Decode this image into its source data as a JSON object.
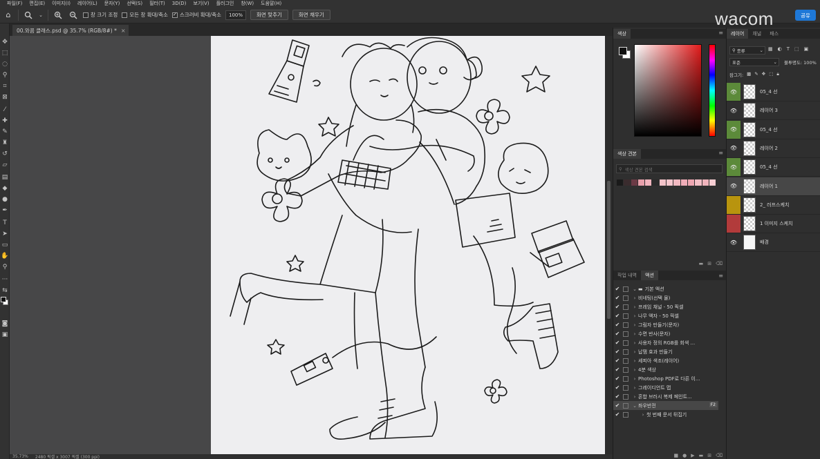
{
  "menubar": [
    "파일(F)",
    "편집(E)",
    "이미지(I)",
    "레이어(L)",
    "문자(Y)",
    "선택(S)",
    "필터(T)",
    "3D(D)",
    "보기(V)",
    "플러그인",
    "창(W)",
    "도움말(H)"
  ],
  "options": {
    "resize_windows": "창 크기 조정",
    "zoom_all": "모든 창 확대/축소",
    "scrubby_zoom": "스크러비 확대/축소",
    "zoom_value": "100%",
    "fit_screen": "화면 맞추기",
    "fill_screen": "화면 채우기"
  },
  "share_label": "공유",
  "brand": "wacom",
  "document": {
    "tab_title": "00.와콤 클래스.psd @ 35.7% (RGB/8#) *",
    "close": "×"
  },
  "status": {
    "zoom": "35.73%",
    "size": "2480 픽셀 x 3007 픽셀 (300 ppi)"
  },
  "color_panel": {
    "tab": "색상",
    "fg": "#111111",
    "bg": "#ffffff"
  },
  "swatches_panel": {
    "tab": "색상 견본",
    "search_placeholder": "색상 견본 검색",
    "colors": [
      "#1a1a1a",
      "#3a2c2e",
      "#6b3a45",
      "#e8a0ab",
      "#f2b5be",
      "#2a2a2a",
      "#f3c3c9",
      "#f6c7cd",
      "#f2b9c1",
      "#f0adb8",
      "#eea6b1",
      "#f3bfc6",
      "#f0b4bc",
      "#f6cdd2"
    ]
  },
  "history_panel": {
    "tabs": [
      "작업 내역",
      "액션"
    ],
    "rows": [
      {
        "label": "기본 액션",
        "arrow": "⌄",
        "folder": true
      },
      {
        "label": "비네팅(선택 물)",
        "arrow": "›"
      },
      {
        "label": "프레임 채널 - 50 픽셀",
        "arrow": "›"
      },
      {
        "label": "나무 액자 - 50 픽셀",
        "arrow": "›"
      },
      {
        "label": "그림자 만들기(문자)",
        "arrow": "›"
      },
      {
        "label": "수면 반사(문자)",
        "arrow": "›"
      },
      {
        "label": "사용자 정의 RGB를 회색 ...",
        "arrow": "›"
      },
      {
        "label": "납땜 효과 만들기",
        "arrow": "›"
      },
      {
        "label": "세피아 색조(레이어)",
        "arrow": "›"
      },
      {
        "label": "4분 색상",
        "arrow": "›"
      },
      {
        "label": "Photoshop PDF로 다른 이...",
        "arrow": "›"
      },
      {
        "label": "그레이디언트 맵",
        "arrow": "›"
      },
      {
        "label": "혼합 브러시 복제 페인트...",
        "arrow": "›"
      },
      {
        "label": "좌우반전",
        "arrow": "⌄",
        "fkey": "F2"
      },
      {
        "label": "첫 번째 문서 뒤집기",
        "arrow": "›",
        "indent": true
      }
    ]
  },
  "layers_panel": {
    "tabs": [
      "레이어",
      "채널",
      "패스"
    ],
    "filter": "종류",
    "blend": "표준",
    "opacity_label": "불투명도: 100%",
    "lock_label": "잠그기:",
    "layers": [
      {
        "name": "05_4 선",
        "tag_color": "#5c8a3a",
        "visible": true,
        "thumb": "check"
      },
      {
        "name": "레이어 3",
        "tag_color": "",
        "visible": true,
        "thumb": "check"
      },
      {
        "name": "05_4 선",
        "tag_color": "#5c8a3a",
        "visible": true,
        "thumb": "check"
      },
      {
        "name": "레이어 2",
        "tag_color": "",
        "visible": true,
        "thumb": "check"
      },
      {
        "name": "05_4 선",
        "tag_color": "#5c8a3a",
        "visible": true,
        "thumb": "check"
      },
      {
        "name": "레이어 1",
        "tag_color": "",
        "visible": true,
        "thumb": "check",
        "selected": true
      },
      {
        "name": "2_ 러프스케치",
        "tag_color": "#b8940e",
        "visible": false,
        "thumb": "check"
      },
      {
        "name": "1 이미지 스케치",
        "tag_color": "#b23b3b",
        "visible": false,
        "thumb": "check"
      },
      {
        "name": "배경",
        "tag_color": "",
        "visible": true,
        "thumb": "white"
      }
    ]
  }
}
